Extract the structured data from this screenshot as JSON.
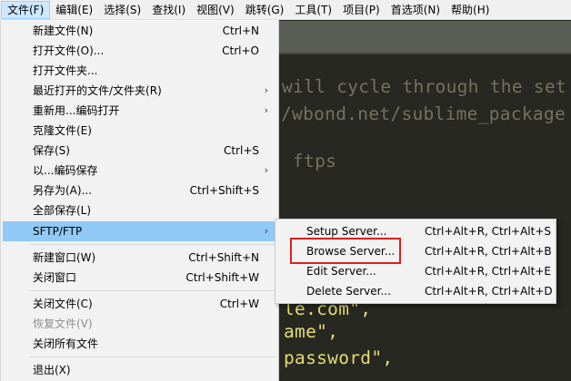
{
  "menubar": {
    "items": [
      "文件(F)",
      "编辑(E)",
      "选择(S)",
      "查找(I)",
      "视图(V)",
      "跳转(G)",
      "工具(T)",
      "项目(P)",
      "首选项(N)",
      "帮助(H)"
    ]
  },
  "editor": {
    "lines": [
      "will cycle through the set",
      "/wbond.net/sublime_package",
      "ftps",
      "le.com\",",
      "ame\",",
      "password\","
    ]
  },
  "file_menu": {
    "items": [
      {
        "label": "新建文件(N)",
        "shortcut": "Ctrl+N"
      },
      {
        "label": "打开文件(O)...",
        "shortcut": "Ctrl+O"
      },
      {
        "label": "打开文件夹...",
        "shortcut": ""
      },
      {
        "label": "最近打开的文件/文件夹(R)",
        "shortcut": ""
      },
      {
        "label": "重新用...编码打开",
        "shortcut": ""
      },
      {
        "label": "克隆文件(E)",
        "shortcut": ""
      },
      {
        "label": "保存(S)",
        "shortcut": "Ctrl+S"
      },
      {
        "label": "以...编码保存",
        "shortcut": ""
      },
      {
        "label": "另存为(A)...",
        "shortcut": "Ctrl+Shift+S"
      },
      {
        "label": "全部保存(L)",
        "shortcut": ""
      },
      {
        "label": "SFTP/FTP",
        "shortcut": ""
      },
      {
        "label": "新建窗口(W)",
        "shortcut": "Ctrl+Shift+N"
      },
      {
        "label": "关闭窗口",
        "shortcut": "Ctrl+Shift+W"
      },
      {
        "label": "关闭文件(C)",
        "shortcut": "Ctrl+W"
      },
      {
        "label": "恢复文件(V)",
        "shortcut": ""
      },
      {
        "label": "关闭所有文件",
        "shortcut": ""
      },
      {
        "label": "退出(X)",
        "shortcut": ""
      }
    ]
  },
  "sftp_submenu": {
    "items": [
      {
        "label": "Setup Server...",
        "shortcut": "Ctrl+Alt+R, Ctrl+Alt+S"
      },
      {
        "label": "Browse Server...",
        "shortcut": "Ctrl+Alt+R, Ctrl+Alt+B"
      },
      {
        "label": "Edit Server...",
        "shortcut": "Ctrl+Alt+R, Ctrl+Alt+E"
      },
      {
        "label": "Delete Server...",
        "shortcut": "Ctrl+Alt+R, Ctrl+Alt+D"
      }
    ]
  },
  "colors": {
    "editor_bg": "#272822",
    "menu_bg": "#f2f2f2",
    "highlight": "#91c9f7",
    "callout_red": "#e21d1d"
  }
}
